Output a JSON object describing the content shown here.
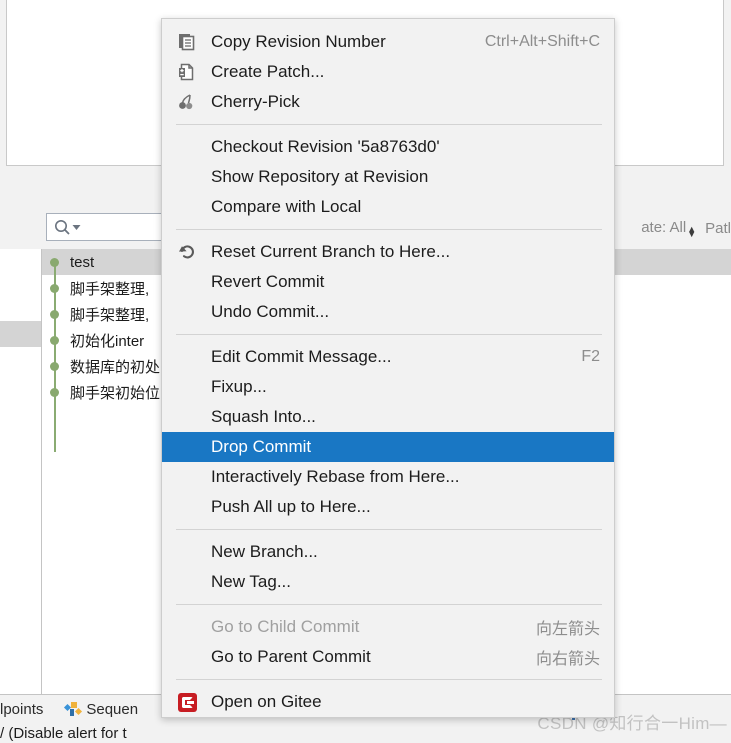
{
  "background": {
    "search": {
      "placeholder": "",
      "value": "",
      "icon": "search-icon"
    },
    "filters": {
      "date_label": "ate: All",
      "path_label": "Patl"
    },
    "commits": [
      {
        "message": "test",
        "selected": true
      },
      {
        "message": "脚手架整理,",
        "selected": false
      },
      {
        "message": "脚手架整理,",
        "selected": false
      },
      {
        "message": "初始化inter",
        "selected": false
      },
      {
        "message": "数据库的初处",
        "selected": false
      },
      {
        "message": "脚手架初始位",
        "selected": false
      }
    ],
    "bottom_tabs": [
      {
        "label": "lpoints",
        "icon": ""
      },
      {
        "label": "Sequen",
        "icon": "sequence-diagram-icon"
      }
    ],
    "bottom_note": "/ (Disable alert for t",
    "watermark": "CSDN @知行合一Him—"
  },
  "context_menu": {
    "groups": [
      {
        "items": [
          {
            "label": "Copy Revision Number",
            "shortcut": "Ctrl+Alt+Shift+C",
            "icon": "copy-icon",
            "state": "normal"
          },
          {
            "label": "Create Patch...",
            "shortcut": "",
            "icon": "create-patch-icon",
            "state": "normal"
          },
          {
            "label": "Cherry-Pick",
            "shortcut": "",
            "icon": "cherry-pick-icon",
            "state": "normal"
          }
        ]
      },
      {
        "items": [
          {
            "label": "Checkout Revision '5a8763d0'",
            "shortcut": "",
            "icon": "",
            "state": "normal"
          },
          {
            "label": "Show Repository at Revision",
            "shortcut": "",
            "icon": "",
            "state": "normal"
          },
          {
            "label": "Compare with Local",
            "shortcut": "",
            "icon": "",
            "state": "normal"
          }
        ]
      },
      {
        "items": [
          {
            "label": "Reset Current Branch to Here...",
            "shortcut": "",
            "icon": "reset-icon",
            "state": "normal"
          },
          {
            "label": "Revert Commit",
            "shortcut": "",
            "icon": "",
            "state": "normal"
          },
          {
            "label": "Undo Commit...",
            "shortcut": "",
            "icon": "",
            "state": "normal"
          }
        ]
      },
      {
        "items": [
          {
            "label": "Edit Commit Message...",
            "shortcut": "F2",
            "icon": "",
            "state": "normal"
          },
          {
            "label": "Fixup...",
            "shortcut": "",
            "icon": "",
            "state": "normal"
          },
          {
            "label": "Squash Into...",
            "shortcut": "",
            "icon": "",
            "state": "normal"
          },
          {
            "label": "Drop Commit",
            "shortcut": "",
            "icon": "",
            "state": "highlighted"
          },
          {
            "label": "Interactively Rebase from Here...",
            "shortcut": "",
            "icon": "",
            "state": "normal"
          },
          {
            "label": "Push All up to Here...",
            "shortcut": "",
            "icon": "",
            "state": "normal"
          }
        ]
      },
      {
        "items": [
          {
            "label": "New Branch...",
            "shortcut": "",
            "icon": "",
            "state": "normal"
          },
          {
            "label": "New Tag...",
            "shortcut": "",
            "icon": "",
            "state": "normal"
          }
        ]
      },
      {
        "items": [
          {
            "label": "Go to Child Commit",
            "shortcut": "向左箭头",
            "icon": "",
            "state": "disabled"
          },
          {
            "label": "Go to Parent Commit",
            "shortcut": "向右箭头",
            "icon": "",
            "state": "normal"
          }
        ]
      },
      {
        "items": [
          {
            "label": "Open on Gitee",
            "shortcut": "",
            "icon": "gitee-icon",
            "state": "normal"
          }
        ]
      }
    ]
  },
  "colors": {
    "highlight": "#1977c4",
    "menu_bg": "#f2f2f2",
    "graph_node": "#89a96f",
    "gitee_red": "#c71d23",
    "selection_gray": "#d4d4d4"
  }
}
